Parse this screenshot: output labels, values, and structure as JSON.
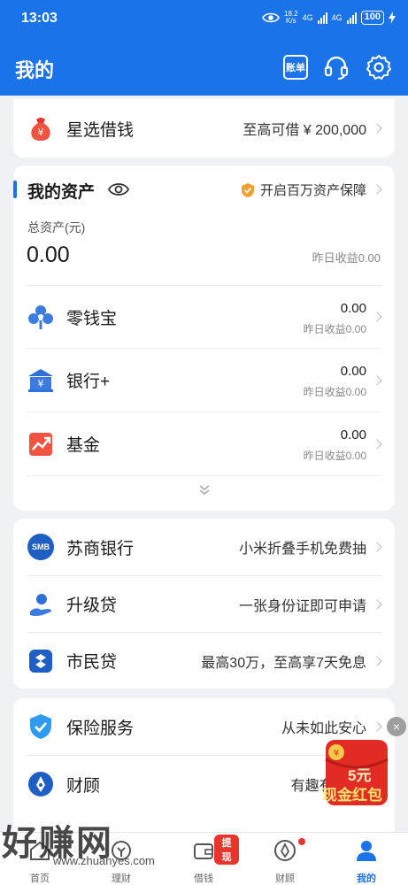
{
  "status_bar": {
    "time": "13:03",
    "speed_value": "18.2",
    "speed_unit": "K/s",
    "net1": "4G",
    "net2": "4G",
    "battery": "100"
  },
  "header": {
    "title": "我的",
    "bill_label": "账单",
    "icons": [
      "bill-icon",
      "headset-icon",
      "gear-icon"
    ]
  },
  "loan_card": {
    "label": "星选借钱",
    "right_text": "至高可借 ¥ 200,000"
  },
  "assets": {
    "title": "我的资产",
    "protect_text": "开启百万资产保障",
    "total_label": "总资产(元)",
    "total_value": "0.00",
    "yesterday_label": "昨日收益",
    "yesterday_value": "0.00",
    "items": [
      {
        "label": "零钱宝",
        "value": "0.00",
        "sub_label": "昨日收益",
        "sub_value": "0.00"
      },
      {
        "label": "银行+",
        "value": "0.00",
        "sub_label": "昨日收益",
        "sub_value": "0.00"
      },
      {
        "label": "基金",
        "value": "0.00",
        "sub_label": "昨日收益",
        "sub_value": "0.00"
      }
    ]
  },
  "services": [
    {
      "label": "苏商银行",
      "right_text": "小米折叠手机免费抽",
      "icon_text": "SMB"
    },
    {
      "label": "升级贷",
      "right_text": "一张身份证即可申请"
    },
    {
      "label": "市民贷",
      "right_text": "最高30万，至高享7天免息"
    }
  ],
  "more": [
    {
      "label": "保险服务",
      "right_text": "从未如此安心"
    },
    {
      "label": "财顾",
      "right_text": "有趣有料有“"
    }
  ],
  "redpack": {
    "amount": "5元",
    "label": "现金红包"
  },
  "nav": {
    "items": [
      {
        "label": "首页"
      },
      {
        "label": "理财"
      },
      {
        "label": "借钱",
        "badge": "提现"
      },
      {
        "label": "财顾"
      },
      {
        "label": "我的"
      }
    ]
  },
  "watermark": {
    "title": "好赚网",
    "url": "www.zhuanyes.com"
  },
  "colors": {
    "brand": "#1a73e8",
    "background": "#f0f1f5",
    "badge_red": "#e8342b"
  }
}
